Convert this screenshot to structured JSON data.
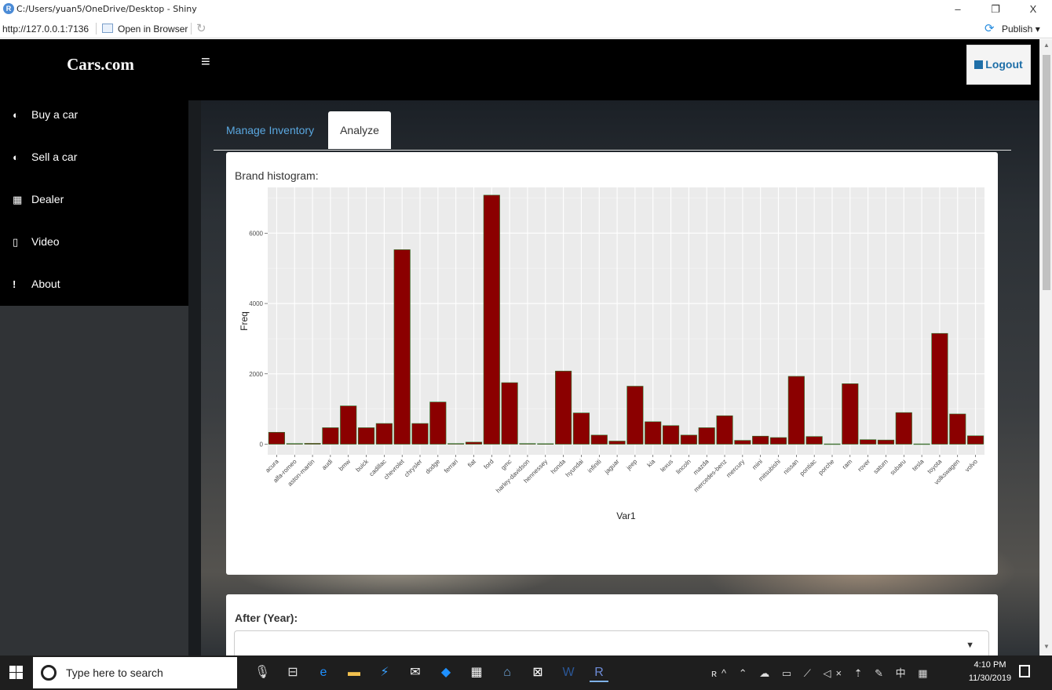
{
  "window": {
    "title": "C:/Users/yuan5/OneDrive/Desktop - Shiny",
    "minimize": "–",
    "maximize": "❐",
    "close": "X"
  },
  "viewer": {
    "url": "http://127.0.0.1:7136",
    "open_in_browser": "Open in Browser",
    "publish": "Publish"
  },
  "app": {
    "brand": "Cars.com",
    "menu_toggle": "≡",
    "logout": "Logout",
    "sidebar": [
      {
        "icon": "dashboard-icon",
        "glyph": "◐",
        "label": "Buy a car"
      },
      {
        "icon": "dashboard-icon",
        "glyph": "◐",
        "label": "Sell a car"
      },
      {
        "icon": "map-icon",
        "glyph": "▦",
        "label": "Dealer"
      },
      {
        "icon": "file-icon",
        "glyph": "▯",
        "label": "Video"
      },
      {
        "icon": "exclamation-icon",
        "glyph": "!",
        "label": "About"
      }
    ],
    "tabs": [
      {
        "label": "Manage Inventory",
        "active": false
      },
      {
        "label": "Analyze",
        "active": true
      }
    ],
    "chart_panel_title": "Brand histogram:",
    "year_label": "After (Year):",
    "year_value": ""
  },
  "chart_data": {
    "type": "bar",
    "xlabel": "Var1",
    "ylabel": "Freq",
    "ylim": [
      0,
      7200
    ],
    "yticks": [
      0,
      2000,
      4000,
      6000
    ],
    "grid": true,
    "bar_color": "#8b0000",
    "bar_outline": "#2e7d32",
    "categories": [
      "acura",
      "alfa-romeo",
      "aston-martin",
      "audi",
      "bmw",
      "buick",
      "cadillac",
      "chevrolet",
      "chrysler",
      "dodge",
      "ferrari",
      "fiat",
      "ford",
      "gmc",
      "harley-davidson",
      "hennessey",
      "honda",
      "hyundai",
      "infiniti",
      "jaguar",
      "jeep",
      "kia",
      "lexus",
      "lincoln",
      "mazda",
      "mercedes-benz",
      "mercury",
      "mini",
      "mitsubishi",
      "nissan",
      "pontiac",
      "porche",
      "ram",
      "rover",
      "saturn",
      "subaru",
      "tesla",
      "toyota",
      "volkswagen",
      "volvo"
    ],
    "values": [
      340,
      20,
      25,
      470,
      1090,
      470,
      590,
      5530,
      590,
      1200,
      20,
      60,
      7080,
      1750,
      20,
      15,
      2080,
      890,
      260,
      90,
      1650,
      640,
      530,
      260,
      470,
      810,
      110,
      230,
      190,
      1930,
      220,
      10,
      1720,
      130,
      120,
      900,
      10,
      3150,
      860,
      240
    ]
  },
  "taskbar": {
    "search_placeholder": "Type here to search",
    "time": "4:10 PM",
    "date": "11/30/2019",
    "apps": [
      {
        "name": "microphone-icon",
        "glyph": "🎙"
      },
      {
        "name": "task-view-icon",
        "glyph": "⊟"
      },
      {
        "name": "edge-icon",
        "glyph": "e"
      },
      {
        "name": "file-explorer-icon",
        "glyph": "▬"
      },
      {
        "name": "power-automate-icon",
        "glyph": "⚡"
      },
      {
        "name": "mail-icon",
        "glyph": "✉"
      },
      {
        "name": "security-icon",
        "glyph": "◆"
      },
      {
        "name": "calendar-icon",
        "glyph": "▦"
      },
      {
        "name": "home-icon",
        "glyph": "⌂"
      },
      {
        "name": "store-icon",
        "glyph": "⊠"
      },
      {
        "name": "word-icon",
        "glyph": "W"
      },
      {
        "name": "r-icon",
        "glyph": "R"
      }
    ],
    "tray": "ʀ^ ⌃ ☁ ▭ ⟋ ◁× ⇡ ✎ 中 ▦"
  }
}
